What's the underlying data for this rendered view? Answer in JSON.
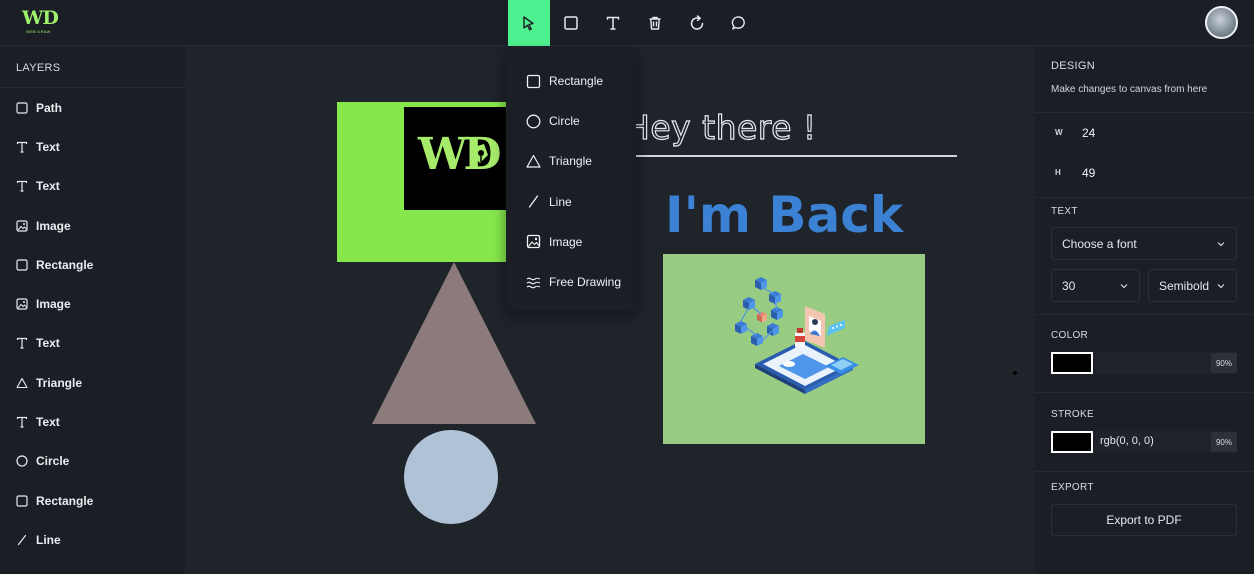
{
  "app": {
    "logo_text": "WD",
    "logo_subtext": "WEB DRAW"
  },
  "toolbar": {
    "tools": [
      {
        "name": "select",
        "icon": "cursor-icon",
        "active": true
      },
      {
        "name": "rectangle",
        "icon": "square-icon",
        "active": false
      },
      {
        "name": "text",
        "icon": "text-icon",
        "active": false
      },
      {
        "name": "delete",
        "icon": "trash-icon",
        "active": false
      },
      {
        "name": "reset",
        "icon": "rotate-icon",
        "active": false
      },
      {
        "name": "comment",
        "icon": "chat-bubble-icon",
        "active": false
      }
    ],
    "active_color": "#4ff08f"
  },
  "layers": {
    "title": "LAYERS",
    "items": [
      {
        "label": "Path",
        "icon": "square-icon"
      },
      {
        "label": "Text",
        "icon": "text-icon"
      },
      {
        "label": "Text",
        "icon": "text-icon"
      },
      {
        "label": "Image",
        "icon": "image-icon"
      },
      {
        "label": "Rectangle",
        "icon": "square-icon"
      },
      {
        "label": "Image",
        "icon": "image-icon"
      },
      {
        "label": "Text",
        "icon": "text-icon"
      },
      {
        "label": "Triangle",
        "icon": "triangle-icon"
      },
      {
        "label": "Text",
        "icon": "text-icon"
      },
      {
        "label": "Circle",
        "icon": "circle-icon"
      },
      {
        "label": "Rectangle",
        "icon": "square-icon"
      },
      {
        "label": "Line",
        "icon": "line-icon"
      }
    ]
  },
  "shapes_menu": {
    "items": [
      {
        "label": "Rectangle",
        "icon": "square-icon"
      },
      {
        "label": "Circle",
        "icon": "circle-icon"
      },
      {
        "label": "Triangle",
        "icon": "triangle-icon"
      },
      {
        "label": "Line",
        "icon": "line-icon"
      },
      {
        "label": "Image",
        "icon": "image-icon"
      },
      {
        "label": "Free Drawing",
        "icon": "wave-icon"
      }
    ]
  },
  "canvas": {
    "texts": {
      "hey": "Hey there !",
      "back": "I'm Back",
      "logo": "WD"
    },
    "colors": {
      "background": "#1f232a",
      "green_rect": "#86e74c",
      "triangle": "#8b7b7a",
      "circle": "#b0c3d6",
      "image_bg": "#98cc82",
      "back_text": "#3c82d4"
    }
  },
  "design": {
    "title": "DESIGN",
    "hint": "Make changes to canvas from here",
    "width_label": "W",
    "width_value": "24",
    "height_label": "H",
    "height_value": "49",
    "text_section": "TEXT",
    "font_select": "Choose a font",
    "font_size": "30",
    "font_weight": "Semibold",
    "color_section": "COLOR",
    "color_hex": "#000000",
    "color_opacity": "90%",
    "stroke_section": "STROKE",
    "stroke_value": "rgb(0, 0, 0)",
    "stroke_opacity": "90%",
    "export_section": "EXPORT",
    "export_button": "Export to PDF"
  }
}
